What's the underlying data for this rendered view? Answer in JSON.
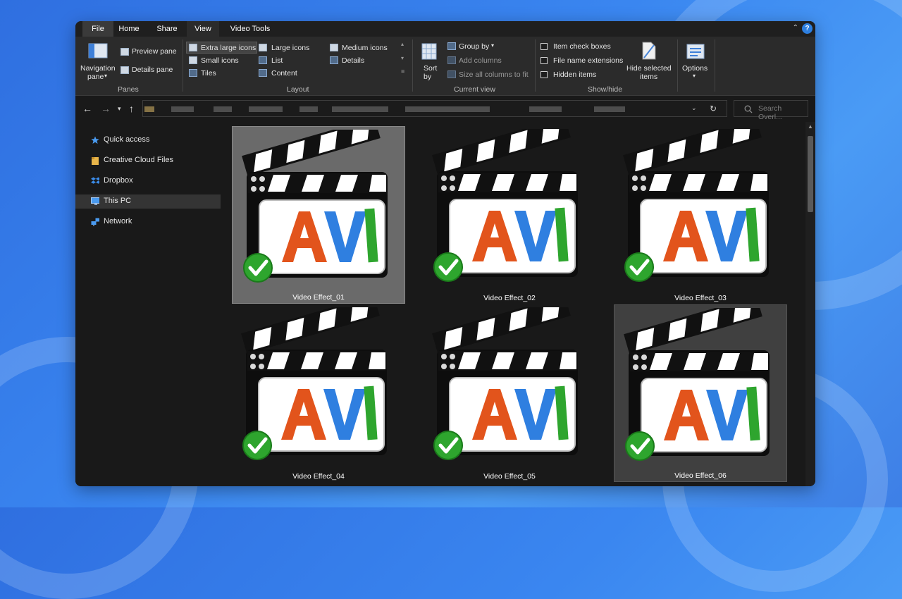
{
  "tabs": [
    "File",
    "Home",
    "Share",
    "View",
    "Video Tools"
  ],
  "active_tab": "View",
  "ribbon": {
    "panes": {
      "navigation_pane_line1": "Navigation",
      "navigation_pane_line2": "pane",
      "preview_pane": "Preview pane",
      "details_pane": "Details pane",
      "group_label": "Panes"
    },
    "layout": {
      "options": [
        "Extra large icons",
        "Large icons",
        "Medium icons",
        "Small icons",
        "List",
        "Details",
        "Tiles",
        "Content"
      ],
      "selected": "Extra large icons",
      "group_label": "Layout"
    },
    "current_view": {
      "sort_line1": "Sort",
      "sort_line2": "by",
      "group_by": "Group by",
      "add_columns": "Add columns",
      "size_columns": "Size all columns to fit",
      "group_label": "Current view"
    },
    "show_hide": {
      "item_check_boxes": "Item check boxes",
      "file_name_extensions": "File name extensions",
      "hidden_items": "Hidden items",
      "hide_selected_line1": "Hide selected",
      "hide_selected_line2": "items",
      "group_label": "Show/hide"
    },
    "options": "Options"
  },
  "search": {
    "placeholder": "Search Overl..."
  },
  "sidebar": {
    "items": [
      {
        "label": "Quick access",
        "icon": "star-icon"
      },
      {
        "label": "Creative Cloud Files",
        "icon": "folder-icon"
      },
      {
        "label": "Dropbox",
        "icon": "dropbox-icon"
      },
      {
        "label": "This PC",
        "icon": "computer-icon"
      },
      {
        "label": "Network",
        "icon": "network-icon"
      }
    ],
    "selected": "This PC"
  },
  "files": [
    {
      "name": "Video Effect_01",
      "badge": "AVI"
    },
    {
      "name": "Video Effect_02",
      "badge": "AVI"
    },
    {
      "name": "Video Effect_03",
      "badge": "AVI"
    },
    {
      "name": "Video Effect_04",
      "badge": "AVI"
    },
    {
      "name": "Video Effect_05",
      "badge": "AVI"
    },
    {
      "name": "Video Effect_06",
      "badge": "AVI"
    }
  ],
  "colors": {
    "avi_a": "#e2541c",
    "avi_v": "#2f7fe0",
    "avi_i": "#2ea52e",
    "check": "#2ea52e",
    "accent": "#2d7fe0"
  }
}
